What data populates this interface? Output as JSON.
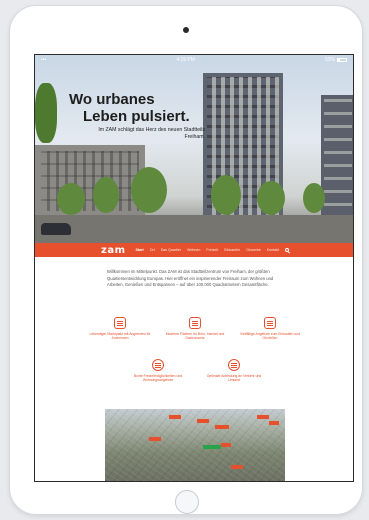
{
  "status_bar": {
    "time": "4:19 PM",
    "battery": "53%"
  },
  "hero": {
    "title_line1": "Wo urbanes",
    "title_line2": "Leben pulsiert.",
    "subtitle": "Im ZAM schlägt das Herz des neuen Stadtteils Freiham."
  },
  "nav": {
    "logo": "zam",
    "items": [
      "Start",
      "Ort",
      "Das Quartier",
      "Wohnen",
      "Freizeit",
      "Einkaufen",
      "Gewerbe",
      "Kontakt"
    ]
  },
  "intro": {
    "text": "Willkommen im Mittelpunkt. Das ZAM ist das Stadtteilzentrum von Freiham, der größten Quartiersentwicklung Europas. Hier eröffnet ein inspirierender Freiraum zum Wohnen und Arbeiten, Genießen und Entspannen – auf über 100.000 Quadratmetern Gesamtfläche."
  },
  "features": [
    {
      "icon": "apartment-icon",
      "text": "Lebendiger Marktplatz mit Angeboten für Jedermann"
    },
    {
      "icon": "building-icon",
      "text": "Moderne Flächen für Büro, Handel und Gastronomie"
    },
    {
      "icon": "shopping-bag-icon",
      "text": "Vielfältige Angebote zum Einkaufen und Genießen"
    },
    {
      "icon": "leisure-icon",
      "text": "Bunte Freizeitmöglichkeiten und Wohnungsangebote"
    },
    {
      "icon": "check-icon",
      "text": "Optimale Anbindung an Verkehr und Umland"
    }
  ],
  "colors": {
    "accent": "#e6502d",
    "marker_green": "#27a34a"
  }
}
